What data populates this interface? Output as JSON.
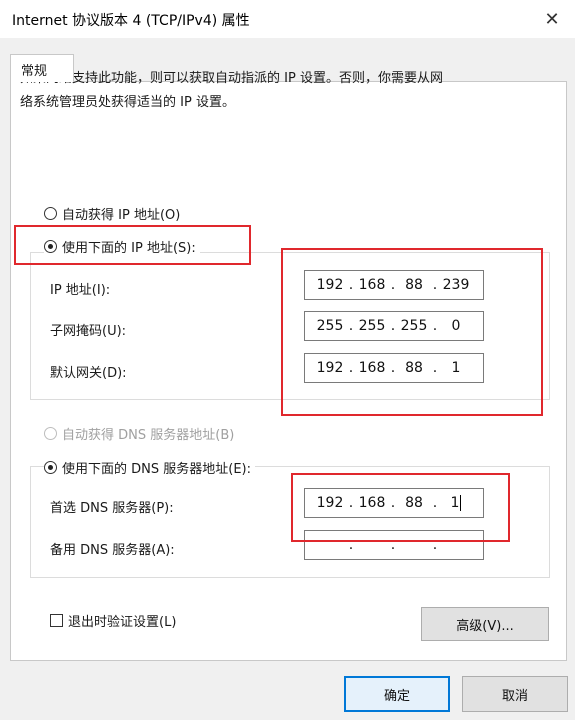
{
  "window": {
    "title": "Internet 协议版本 4 (TCP/IPv4) 属性",
    "close_glyph": "✕"
  },
  "tabs": [
    {
      "label": "常规"
    }
  ],
  "description": {
    "line1": "如果网络支持此功能，则可以获取自动指派的 IP 设置。否则，你需要从网",
    "line2": "络系统管理员处获得适当的 IP 设置。"
  },
  "ip_mode": {
    "auto_label": "自动获得 IP 地址(O)",
    "manual_label": "使用下面的 IP 地址(S):",
    "selected": "manual"
  },
  "ip_fields": {
    "ip": {
      "label": "IP 地址(I):",
      "octets": [
        "192",
        "168",
        "88",
        "239"
      ]
    },
    "subnet": {
      "label": "子网掩码(U):",
      "octets": [
        "255",
        "255",
        "255",
        "0"
      ]
    },
    "gateway": {
      "label": "默认网关(D):",
      "octets": [
        "192",
        "168",
        "88",
        "1"
      ]
    }
  },
  "dns_mode": {
    "auto_label": "自动获得 DNS 服务器地址(B)",
    "manual_label": "使用下面的 DNS 服务器地址(E):",
    "selected": "manual"
  },
  "dns_fields": {
    "preferred": {
      "label": "首选 DNS 服务器(P):",
      "octets": [
        "192",
        "168",
        "88",
        "1"
      ]
    },
    "alternate": {
      "label": "备用 DNS 服务器(A):",
      "octets": [
        "",
        "",
        "",
        ""
      ]
    }
  },
  "validate_checkbox": {
    "label": "退出时验证设置(L)",
    "checked": false
  },
  "buttons": {
    "advanced": "高级(V)...",
    "ok": "确定",
    "cancel": "取消"
  },
  "colors": {
    "highlight_box": "#e0282d",
    "default_button_border": "#0078d7"
  }
}
